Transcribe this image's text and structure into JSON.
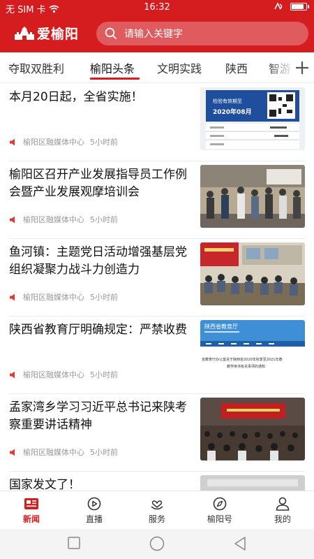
{
  "status_bar": {
    "carrier": "无 SIM 卡",
    "time": "16:32",
    "battery_level": 0.92
  },
  "header": {
    "logo_text": "爱榆阳",
    "search_placeholder": "请输入关键字",
    "brand_color": "#d51c1f"
  },
  "tabs": [
    {
      "label": "夺取双胜利",
      "active": false
    },
    {
      "label": "榆阳头条",
      "active": true
    },
    {
      "label": "文明实践",
      "active": false
    },
    {
      "label": "陕西",
      "active": false
    },
    {
      "label": "智游",
      "active": false
    }
  ],
  "articles": [
    {
      "title": "本月20日起，全省实施！",
      "source": "榆阳区融媒体中心",
      "time": "5小时前",
      "thumb": "vehicle-inspection-label"
    },
    {
      "title": "榆阳区召开产业发展指导员工作例会暨产业发展观摩培训会",
      "source": "榆阳区融媒体中心",
      "time": "5小时前",
      "thumb": "warehouse-group-photo"
    },
    {
      "title": "鱼河镇：主题党日活动增强基层党组织凝聚力战斗力创造力",
      "source": "榆阳区融媒体中心",
      "time": "5小时前",
      "thumb": "meeting-room-photo"
    },
    {
      "title": "陕西省教育厅明确规定：严禁收费",
      "source": "榆阳区融媒体中心",
      "time": "5小时前",
      "thumb": "education-website-screenshot"
    },
    {
      "title": "孟家湾乡学习习近平总书记来陕考察重要讲话精神",
      "source": "榆阳区融媒体中心",
      "time": "5小时前",
      "thumb": "conference-hall-photo"
    },
    {
      "title": "国家发文了！",
      "source": "",
      "time": "",
      "thumb": "document-photo"
    }
  ],
  "thumb_text": {
    "inspection_label": "检验有效期至",
    "inspection_date": "2020年08月",
    "edu_banner": "陕西省教育厅",
    "edu_notice": "省教育厅办公室关于陕西省2020年秋季至2021年春",
    "edu_notice2": "教学用书有关事项的通知"
  },
  "tabbar": [
    {
      "label": "新闻",
      "icon": "news-icon",
      "active": true
    },
    {
      "label": "直播",
      "icon": "live-play-icon",
      "active": false
    },
    {
      "label": "服务",
      "icon": "service-heart-icon",
      "active": false
    },
    {
      "label": "榆阳号",
      "icon": "compass-icon",
      "active": false
    },
    {
      "label": "我的",
      "icon": "profile-icon",
      "active": false
    }
  ]
}
